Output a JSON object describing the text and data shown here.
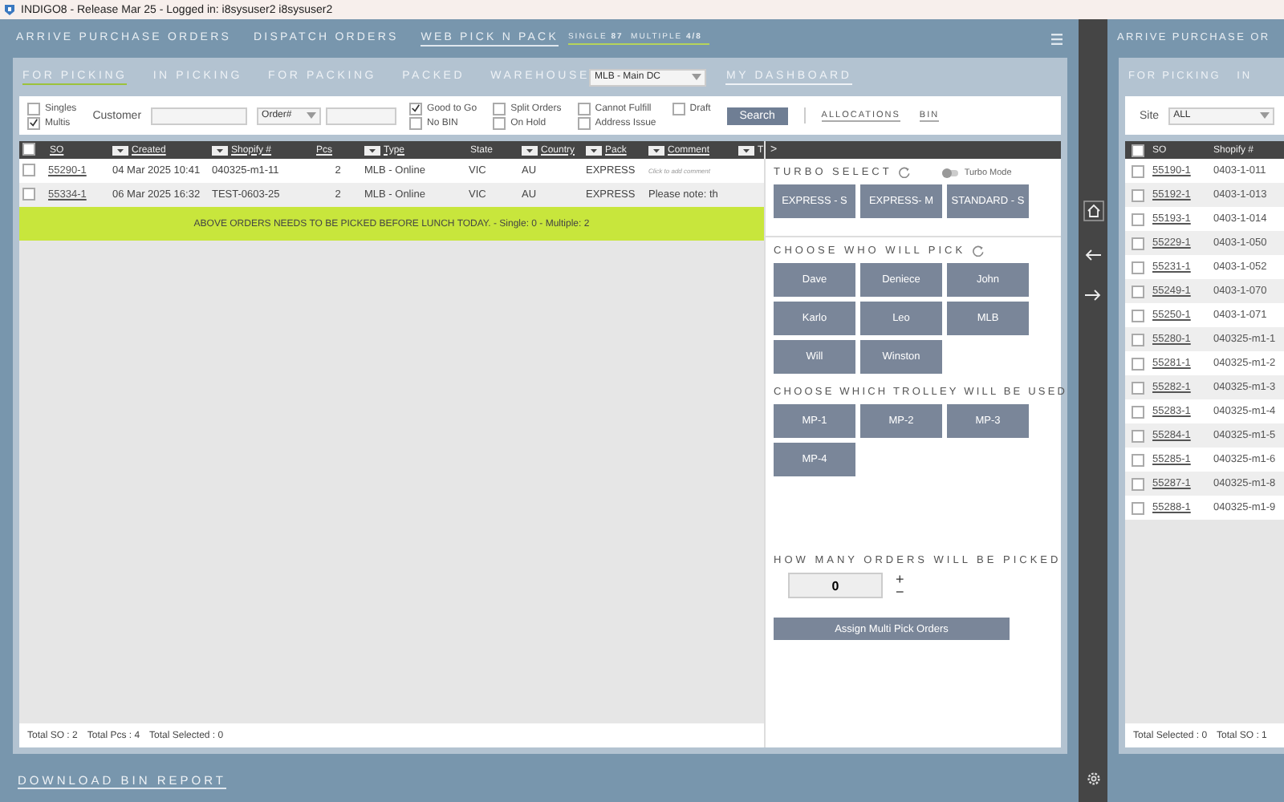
{
  "window": {
    "title": "INDIGO8 - Release Mar 25 - Logged in: i8sysuser2 i8sysuser2"
  },
  "nav": [
    {
      "label": "ARRIVE PURCHASE ORDERS",
      "selected": false
    },
    {
      "label": "DISPATCH ORDERS",
      "selected": false
    },
    {
      "label": "WEB PICK N PACK",
      "selected": true
    }
  ],
  "counts": [
    {
      "label": "SINGLE",
      "value": "87"
    },
    {
      "label": "MULTIPLE",
      "value": "4/8"
    }
  ],
  "subtabs": [
    {
      "label": "FOR PICKING",
      "selected": true
    },
    {
      "label": "IN PICKING",
      "selected": false
    },
    {
      "label": "FOR PACKING",
      "selected": false
    },
    {
      "label": "PACKED",
      "selected": false
    }
  ],
  "warehouse": {
    "label": "WAREHOUSE",
    "value": "MLB - Main DC"
  },
  "dashboard_link": "MY DASHBOARD",
  "filters": {
    "type_options": [
      {
        "label": "Singles",
        "checked": false
      },
      {
        "label": "Multis",
        "checked": true
      }
    ],
    "customer_label": "Customer",
    "search_by": "Order#",
    "status_options": [
      [
        {
          "label": "Good to Go",
          "checked": true
        },
        {
          "label": "No BIN",
          "checked": false
        }
      ],
      [
        {
          "label": "Split Orders",
          "checked": false
        },
        {
          "label": "On Hold",
          "checked": false
        }
      ],
      [
        {
          "label": "Cannot Fulfill",
          "checked": false
        },
        {
          "label": "Address Issue",
          "checked": false
        }
      ],
      [
        {
          "label": "Draft",
          "checked": false
        }
      ]
    ],
    "search_button": "Search",
    "links": [
      "ALLOCATIONS",
      "BIN"
    ]
  },
  "table": {
    "all_checked": false,
    "columns": [
      {
        "label": "SO",
        "filter": false,
        "sortable": true
      },
      {
        "label": "Created",
        "filter": true,
        "sortable": true
      },
      {
        "label": "Shopify #",
        "filter": true,
        "sortable": true
      },
      {
        "label": "Pcs",
        "filter": false,
        "sortable": true
      },
      {
        "label": "Type",
        "filter": true,
        "sortable": true
      },
      {
        "label": "State",
        "filter": false,
        "sortable": false
      },
      {
        "label": "Country",
        "filter": true,
        "sortable": true
      },
      {
        "label": "Pack",
        "filter": true,
        "sortable": true
      },
      {
        "label": "Comment",
        "filter": true,
        "sortable": true
      },
      {
        "label": "T",
        "filter": true,
        "sortable": false
      }
    ],
    "rows": [
      {
        "checked": false,
        "comment_hint": true,
        "cells": [
          "55290-1",
          "04 Mar 2025 10:41",
          "040325-m1-11",
          "2",
          "MLB - Online",
          "VIC",
          "AU",
          "EXPRESS",
          "Click to add comment"
        ]
      },
      {
        "checked": false,
        "comment_hint": false,
        "cells": [
          "55334-1",
          "06 Mar 2025 16:32",
          "TEST-0603-25",
          "2",
          "MLB - Online",
          "VIC",
          "AU",
          "EXPRESS",
          "Please note: th"
        ]
      }
    ],
    "banner": "ABOVE ORDERS NEEDS TO BE PICKED BEFORE LUNCH TODAY. - Single: 0 - Multiple: 2",
    "totals": [
      "Total SO : 2",
      "Total Pcs : 4",
      "Total Selected : 0"
    ]
  },
  "pick_panel": {
    "header": ">",
    "turbo": {
      "title": "TURBO SELECT",
      "toggle_label": "Turbo Mode",
      "on": false,
      "buttons": [
        "EXPRESS - S",
        "EXPRESS- M",
        "STANDARD - S"
      ]
    },
    "pickers": {
      "title": "CHOOSE WHO WILL PICK",
      "buttons": [
        "Dave",
        "Deniece",
        "John",
        "Karlo",
        "Leo",
        "MLB",
        "Will",
        "Winston"
      ]
    },
    "trolleys": {
      "title": "CHOOSE WHICH TROLLEY WILL BE USED",
      "buttons": [
        "MP-1",
        "MP-2",
        "MP-3",
        "MP-4"
      ]
    },
    "quantity": {
      "title": "HOW MANY ORDERS WILL BE PICKED",
      "value": "0",
      "plus": "+",
      "minus": "−"
    },
    "assign_button": "Assign Multi Pick Orders"
  },
  "download_link": "DOWNLOAD BIN REPORT",
  "second_window": {
    "nav": "ARRIVE PURCHASE OR",
    "subtabs": [
      "FOR PICKING",
      "IN"
    ],
    "site": {
      "label": "Site",
      "value": "ALL"
    },
    "all_checked": false,
    "columns": [
      "SO",
      "Shopify #"
    ],
    "rows": [
      {
        "so": "55190-1",
        "shopify": "0403-1-011",
        "checked": false
      },
      {
        "so": "55192-1",
        "shopify": "0403-1-013",
        "checked": false
      },
      {
        "so": "55193-1",
        "shopify": "0403-1-014",
        "checked": false
      },
      {
        "so": "55229-1",
        "shopify": "0403-1-050",
        "checked": false
      },
      {
        "so": "55231-1",
        "shopify": "0403-1-052",
        "checked": false
      },
      {
        "so": "55249-1",
        "shopify": "0403-1-070",
        "checked": false
      },
      {
        "so": "55250-1",
        "shopify": "0403-1-071",
        "checked": false
      },
      {
        "so": "55280-1",
        "shopify": "040325-m1-1",
        "checked": false
      },
      {
        "so": "55281-1",
        "shopify": "040325-m1-2",
        "checked": false
      },
      {
        "so": "55282-1",
        "shopify": "040325-m1-3",
        "checked": false
      },
      {
        "so": "55283-1",
        "shopify": "040325-m1-4",
        "checked": false
      },
      {
        "so": "55284-1",
        "shopify": "040325-m1-5",
        "checked": false
      },
      {
        "so": "55285-1",
        "shopify": "040325-m1-6",
        "checked": false
      },
      {
        "so": "55287-1",
        "shopify": "040325-m1-8",
        "checked": false
      },
      {
        "so": "55288-1",
        "shopify": "040325-m1-9",
        "checked": false
      }
    ],
    "totals": [
      "Total Selected : 0",
      "Total SO : 1"
    ]
  }
}
